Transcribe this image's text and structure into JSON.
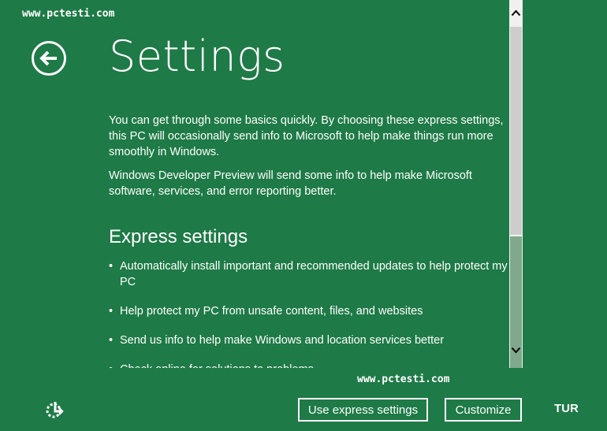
{
  "watermark": {
    "top": "www.pctesti.com",
    "bottom": "www.pctesti.com"
  },
  "header": {
    "title": "Settings"
  },
  "intro": {
    "p1": "You can get through some basics quickly. By choosing these express settings, this PC will occasionally send info to Microsoft to help make things run more smoothly in Windows.",
    "p2": "Windows Developer Preview will send some info to help make Microsoft software, services, and error reporting better."
  },
  "express": {
    "heading": "Express settings",
    "items": [
      "Automatically install important and recommended updates to help protect my PC",
      "Help protect my PC from unsafe content, files, and websites",
      "Send us info to help make Windows and location services better",
      "Check online for solutions to problems"
    ]
  },
  "footer": {
    "express_button": "Use express settings",
    "customize_button": "Customize",
    "language": "TUR"
  },
  "icons": {
    "back": "back-arrow-icon",
    "ease_of_access": "ease-of-access-icon",
    "scroll_up": "chevron-up-icon",
    "scroll_down": "chevron-down-icon"
  },
  "colors": {
    "background": "#1e7a46",
    "text": "#ffffff"
  }
}
